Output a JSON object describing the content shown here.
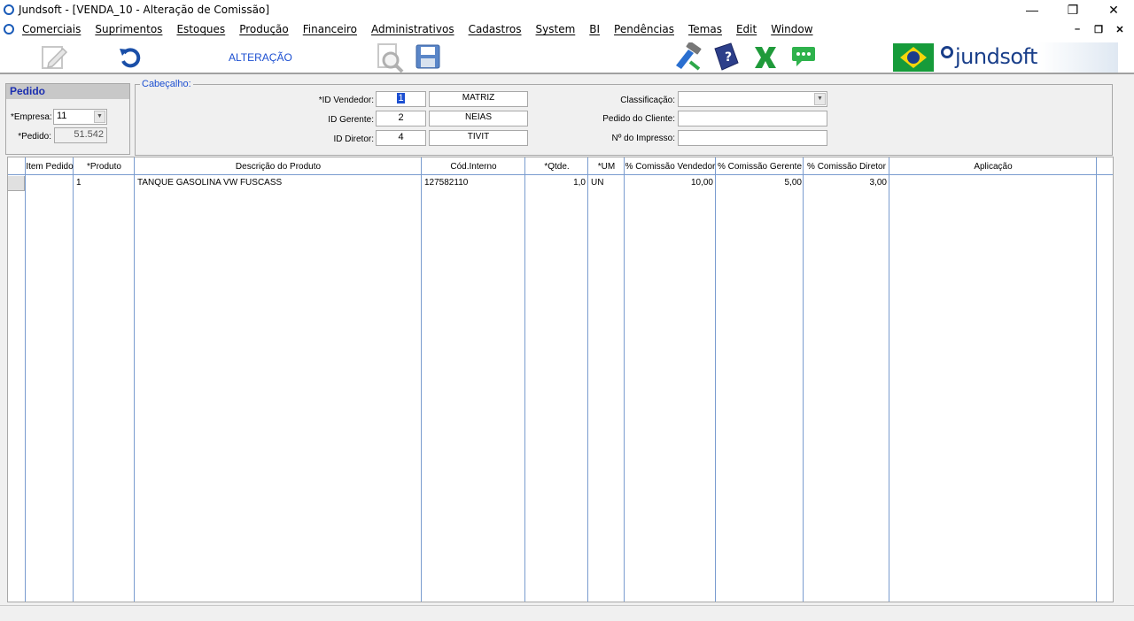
{
  "window": {
    "title": "Jundsoft - [VENDA_10 - Alteração de Comissão]",
    "minimize": "—",
    "maximize": "❐",
    "close": "✕"
  },
  "menu": {
    "items": [
      "Comerciais",
      "Suprimentos",
      "Estoques",
      "Produção",
      "Financeiro",
      "Administrativos",
      "Cadastros",
      "System",
      "BI",
      "Pendências",
      "Temas",
      "Edit",
      "Window"
    ],
    "mdi_minimize": "–",
    "mdi_restore": "❐",
    "mdi_close": "✕"
  },
  "toolbar": {
    "mode_label": "ALTERAÇÃO",
    "icons": [
      "edit-icon",
      "undo-icon",
      "search-document-icon",
      "save-icon",
      "tools-icon",
      "help-book-icon",
      "excel-icon",
      "chat-icon"
    ],
    "brand_text": "jundsoft"
  },
  "pedido": {
    "header": "Pedido",
    "empresa_label": "*Empresa:",
    "empresa_value": "11",
    "pedido_label": "*Pedido:",
    "pedido_value": "51.542"
  },
  "cabecalho": {
    "legend": "Cabeçalho:",
    "vendedor_label": "*ID Vendedor:",
    "vendedor_id": "1",
    "vendedor_name": "MATRIZ",
    "gerente_label": "ID Gerente:",
    "gerente_id": "2",
    "gerente_name": "NEIAS",
    "diretor_label": "ID Diretor:",
    "diretor_id": "4",
    "diretor_name": "TIVIT",
    "classificacao_label": "Classificação:",
    "classificacao_value": "",
    "pedido_cliente_label": "Pedido do Cliente:",
    "pedido_cliente_value": "",
    "impresso_label": "Nº do Impresso:",
    "impresso_value": ""
  },
  "grid": {
    "columns": [
      "Item Pedido",
      "*Produto",
      "Descrição do Produto",
      "Cód.Interno",
      "*Qtde.",
      "*UM",
      "% Comissão Vendedor",
      "% Comissão Gerente",
      "% Comissão Diretor",
      "Aplicação"
    ],
    "rows": [
      {
        "item_pedido": "",
        "produto": "1",
        "descricao": "TANQUE GASOLINA VW FUSCASS",
        "cod_interno": "127582110",
        "qtde": "1,0",
        "um": "UN",
        "com_vendedor": "10,00",
        "com_gerente": "5,00",
        "com_diretor": "3,00",
        "aplicacao": ""
      }
    ]
  },
  "colors": {
    "accent_blue": "#1c4fd1",
    "grid_line": "#7a9ccf"
  }
}
